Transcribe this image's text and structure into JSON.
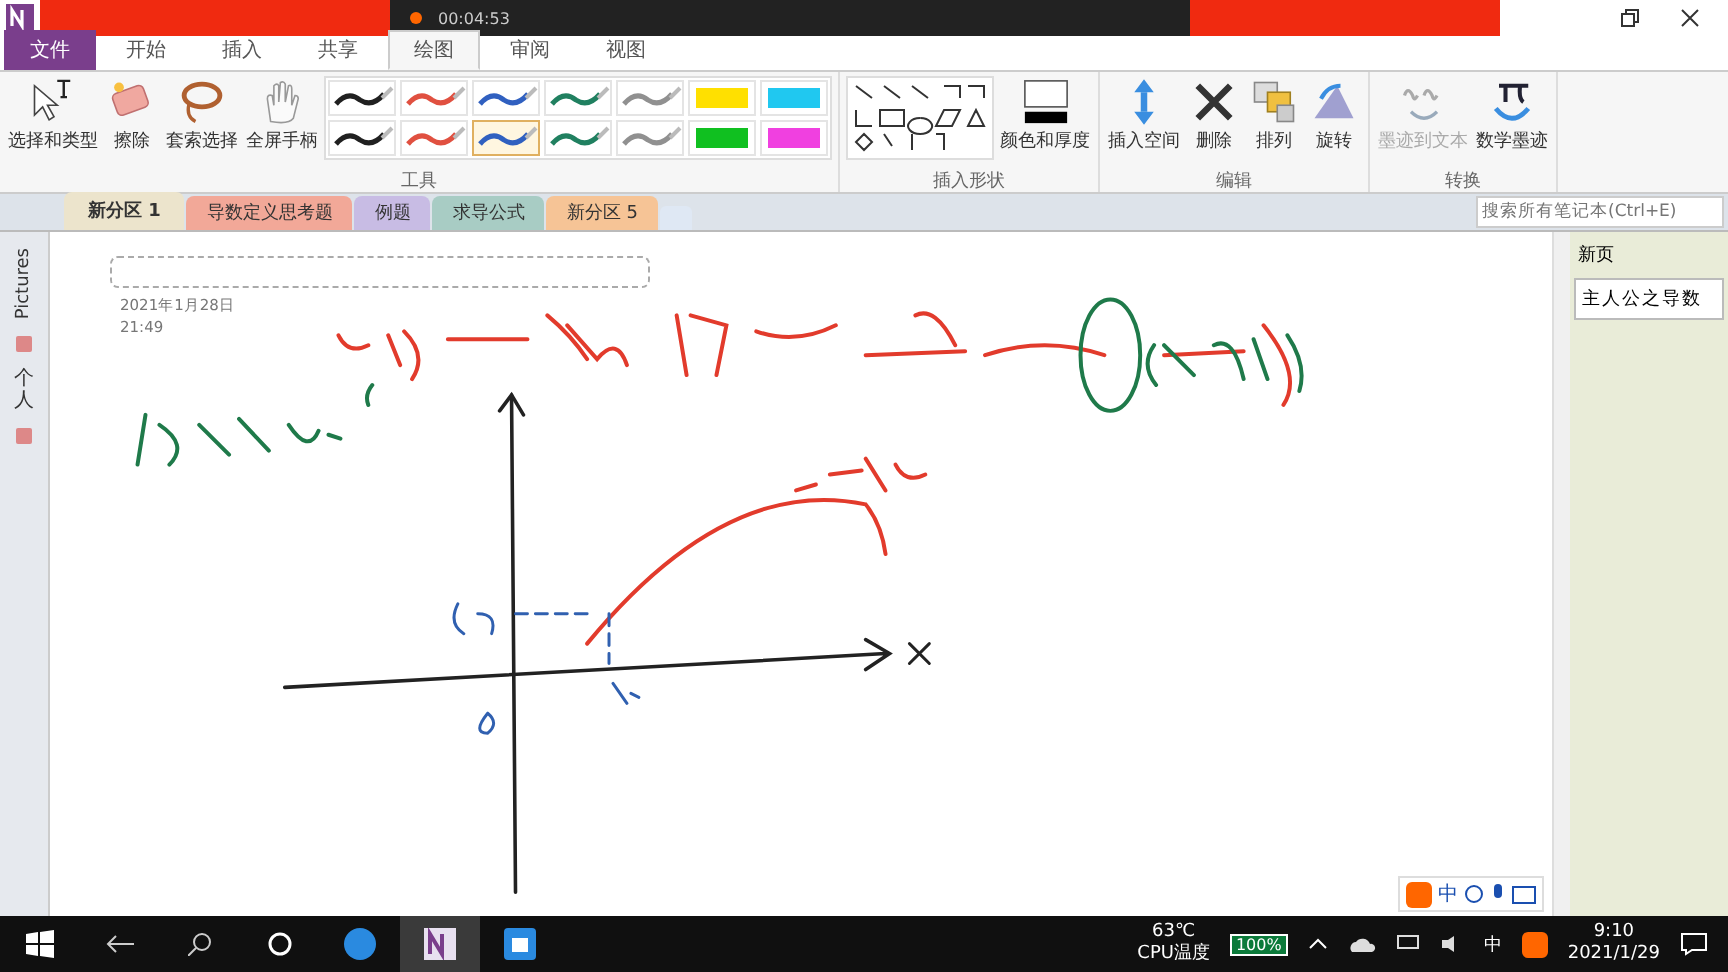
{
  "recorder": {
    "timer": "00:04:53"
  },
  "ribbon_tabs": [
    {
      "label": "文件",
      "kind": "file",
      "selected": false
    },
    {
      "label": "开始",
      "kind": "tab",
      "selected": false
    },
    {
      "label": "插入",
      "kind": "tab",
      "selected": false
    },
    {
      "label": "共享",
      "kind": "tab",
      "selected": false
    },
    {
      "label": "绘图",
      "kind": "tab",
      "selected": true
    },
    {
      "label": "审阅",
      "kind": "tab",
      "selected": false
    },
    {
      "label": "视图",
      "kind": "tab",
      "selected": false
    }
  ],
  "tools_group": {
    "label": "工具",
    "tools": [
      {
        "label": "选择和类型",
        "kind": "select"
      },
      {
        "label": "擦除",
        "kind": "eraser"
      },
      {
        "label": "套索选择",
        "kind": "lasso"
      },
      {
        "label": "全屏手柄",
        "kind": "hand"
      }
    ],
    "pens": [
      {
        "kind": "pen",
        "color": "#202020",
        "selected": false
      },
      {
        "kind": "pen",
        "color": "#e05040",
        "selected": false
      },
      {
        "kind": "pen",
        "color": "#3060c0",
        "selected": false
      },
      {
        "kind": "pen",
        "color": "#208060",
        "selected": false
      },
      {
        "kind": "pen",
        "color": "#909090",
        "selected": false
      },
      {
        "kind": "highlighter",
        "color": "#ffe000",
        "selected": false
      },
      {
        "kind": "highlighter",
        "color": "#20c8f0",
        "selected": false
      },
      {
        "kind": "pen",
        "color": "#202020",
        "selected": false
      },
      {
        "kind": "pen",
        "color": "#e05040",
        "selected": false
      },
      {
        "kind": "pen",
        "color": "#3060c0",
        "selected": true
      },
      {
        "kind": "pen",
        "color": "#208060",
        "selected": false
      },
      {
        "kind": "pen",
        "color": "#909090",
        "selected": false
      },
      {
        "kind": "highlighter",
        "color": "#10c020",
        "selected": false
      },
      {
        "kind": "highlighter",
        "color": "#f040e0",
        "selected": false
      }
    ]
  },
  "shapes_group": {
    "label": "插入形状",
    "color_button": "颜色和厚度"
  },
  "edit_group": {
    "label": "编辑",
    "tools": [
      {
        "label": "插入空间",
        "kind": "space",
        "disabled": false
      },
      {
        "label": "删除",
        "kind": "delete",
        "disabled": false
      },
      {
        "label": "排列",
        "kind": "arrange",
        "disabled": false
      },
      {
        "label": "旋转",
        "kind": "rotate",
        "disabled": false
      }
    ]
  },
  "convert_group": {
    "label": "转换",
    "tools": [
      {
        "label": "墨迹到文本",
        "kind": "ink-to-text",
        "disabled": true
      },
      {
        "label": "数学墨迹",
        "kind": "math",
        "disabled": false
      }
    ]
  },
  "sections": [
    {
      "label": "新分区 1",
      "color": "#ece4cc",
      "selected": true
    },
    {
      "label": "导数定义思考题",
      "color": "#f2a898",
      "selected": false
    },
    {
      "label": "例题",
      "color": "#c8bce4",
      "selected": false
    },
    {
      "label": "求导公式",
      "color": "#a8ccc4",
      "selected": false
    },
    {
      "label": "新分区 5",
      "color": "#f6c496",
      "selected": false
    }
  ],
  "search": {
    "placeholder": "搜索所有笔记本(Ctrl+E)"
  },
  "notebooks": [
    {
      "label": "Pictures",
      "kind": "latin"
    },
    {
      "label": "个人",
      "kind": "cjk"
    }
  ],
  "page": {
    "date": "2021年1月28日",
    "time": "21:49"
  },
  "pages_pane": {
    "new_page": "新页",
    "pages": [
      {
        "label": "主人公之导数",
        "selected": true
      }
    ]
  },
  "ime_bar": {
    "mode": "中"
  },
  "taskbar": {
    "temperature": "63℃",
    "temperature_label": "CPU温度",
    "battery": "100%",
    "input_mode": "中",
    "time": "9:10",
    "date": "2021/1/29"
  }
}
